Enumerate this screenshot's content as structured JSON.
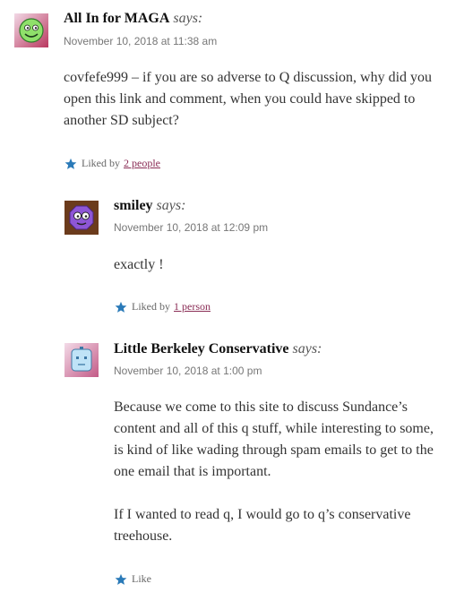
{
  "comments": [
    {
      "author": "All In for MAGA",
      "says": "says:",
      "date": "November 10, 2018 at 11:38 am",
      "paragraphs": [
        "covfefe999 – if you are so adverse to Q discussion, why did you open this link and comment, when you could have skipped to another SD subject?"
      ],
      "like_prefix": "Liked by",
      "like_link": "2 people",
      "avatar_icon": "green-smiley-face-icon"
    },
    {
      "author": "smiley",
      "says": "says:",
      "date": "November 10, 2018 at 12:09 pm",
      "paragraphs": [
        "exactly !"
      ],
      "like_prefix": "Liked by",
      "like_link": "1 person",
      "avatar_icon": "purple-octagon-face-icon"
    },
    {
      "author": "Little Berkeley Conservative",
      "says": "says:",
      "date": "November 10, 2018 at 1:00 pm",
      "paragraphs": [
        "Because we come to this site to discuss Sundance’s content and all of this q stuff, while interesting to some, is kind of like wading through spam emails to get to the one email that is important.",
        "If I wanted to read q, I would go to q’s conservative treehouse."
      ],
      "like_prefix": "Like",
      "like_link": "",
      "avatar_icon": "blue-robot-face-icon"
    }
  ],
  "colors": {
    "star": "#2a7ab8",
    "link": "#8a2c55"
  }
}
